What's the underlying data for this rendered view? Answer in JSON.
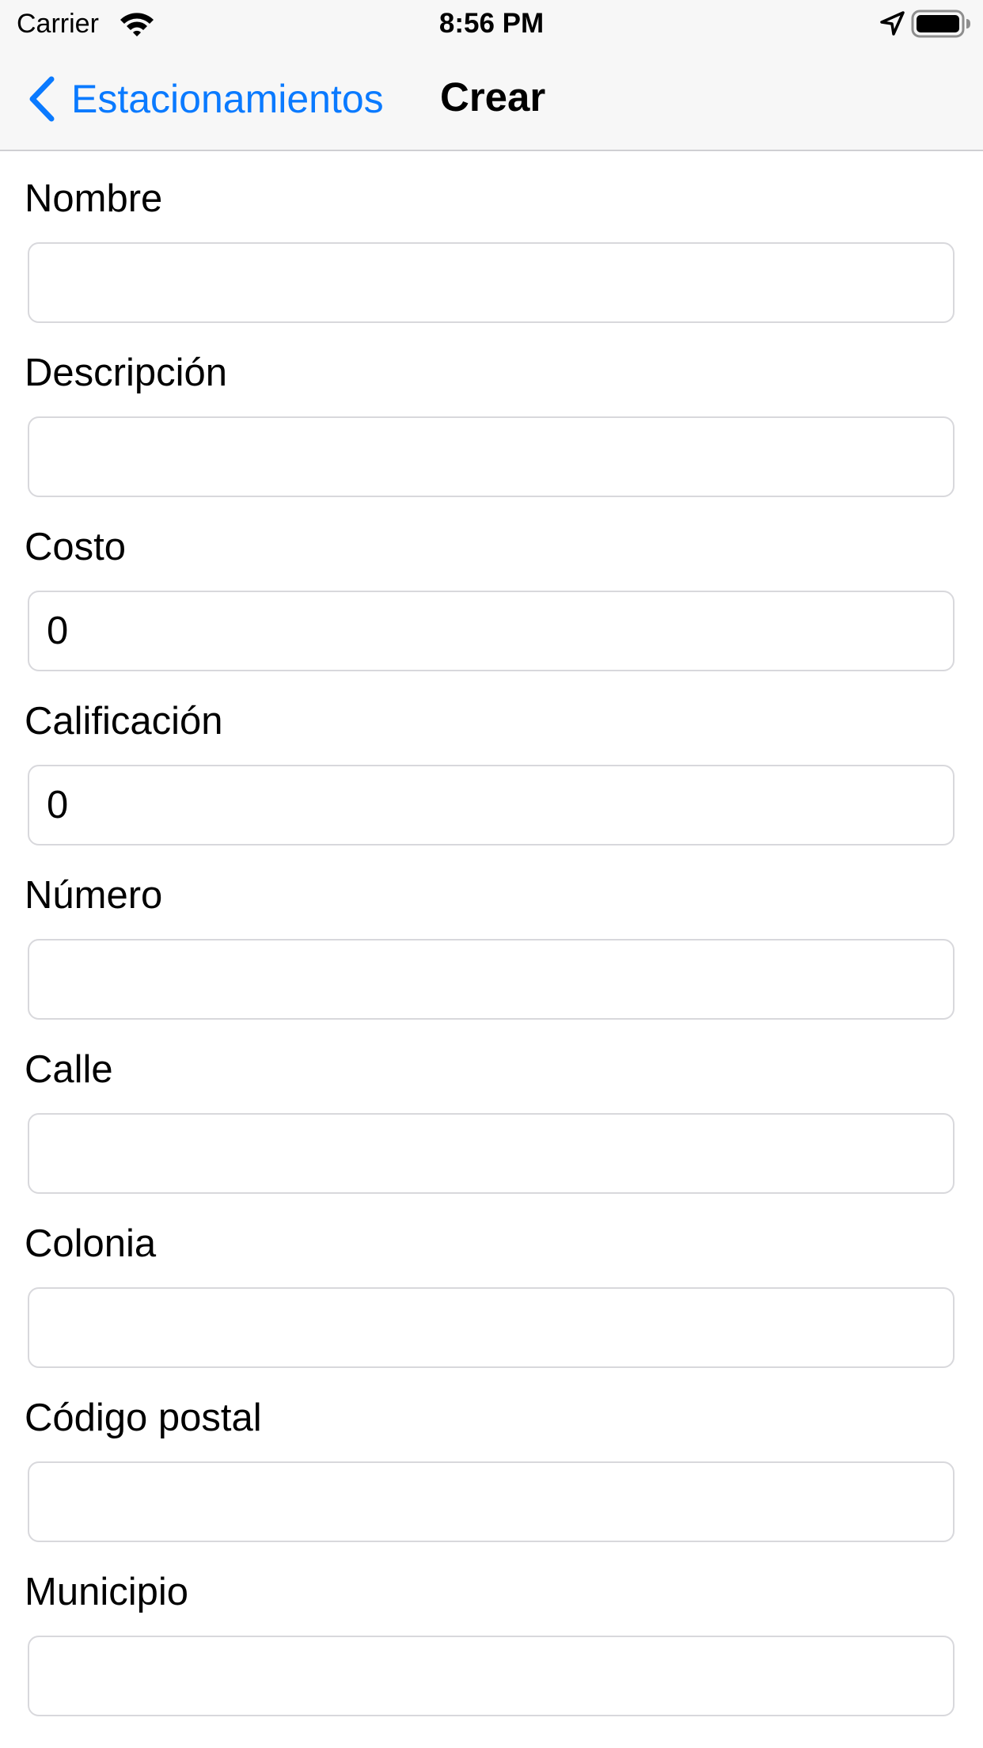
{
  "status_bar": {
    "carrier": "Carrier",
    "time": "8:56 PM",
    "icons": [
      "wifi-icon",
      "location-arrow-icon",
      "battery-icon"
    ]
  },
  "nav": {
    "back_label": "Estacionamientos",
    "title": "Crear",
    "back_icon": "chevron-left-icon",
    "accent_color": "#0a7aff"
  },
  "form": {
    "fields": [
      {
        "label": "Nombre",
        "value": ""
      },
      {
        "label": "Descripción",
        "value": ""
      },
      {
        "label": "Costo",
        "value": "0"
      },
      {
        "label": "Calificación",
        "value": "0"
      },
      {
        "label": "Número",
        "value": ""
      },
      {
        "label": "Calle",
        "value": ""
      },
      {
        "label": "Colonia",
        "value": ""
      },
      {
        "label": "Código postal",
        "value": ""
      },
      {
        "label": "Municipio",
        "value": ""
      }
    ]
  }
}
